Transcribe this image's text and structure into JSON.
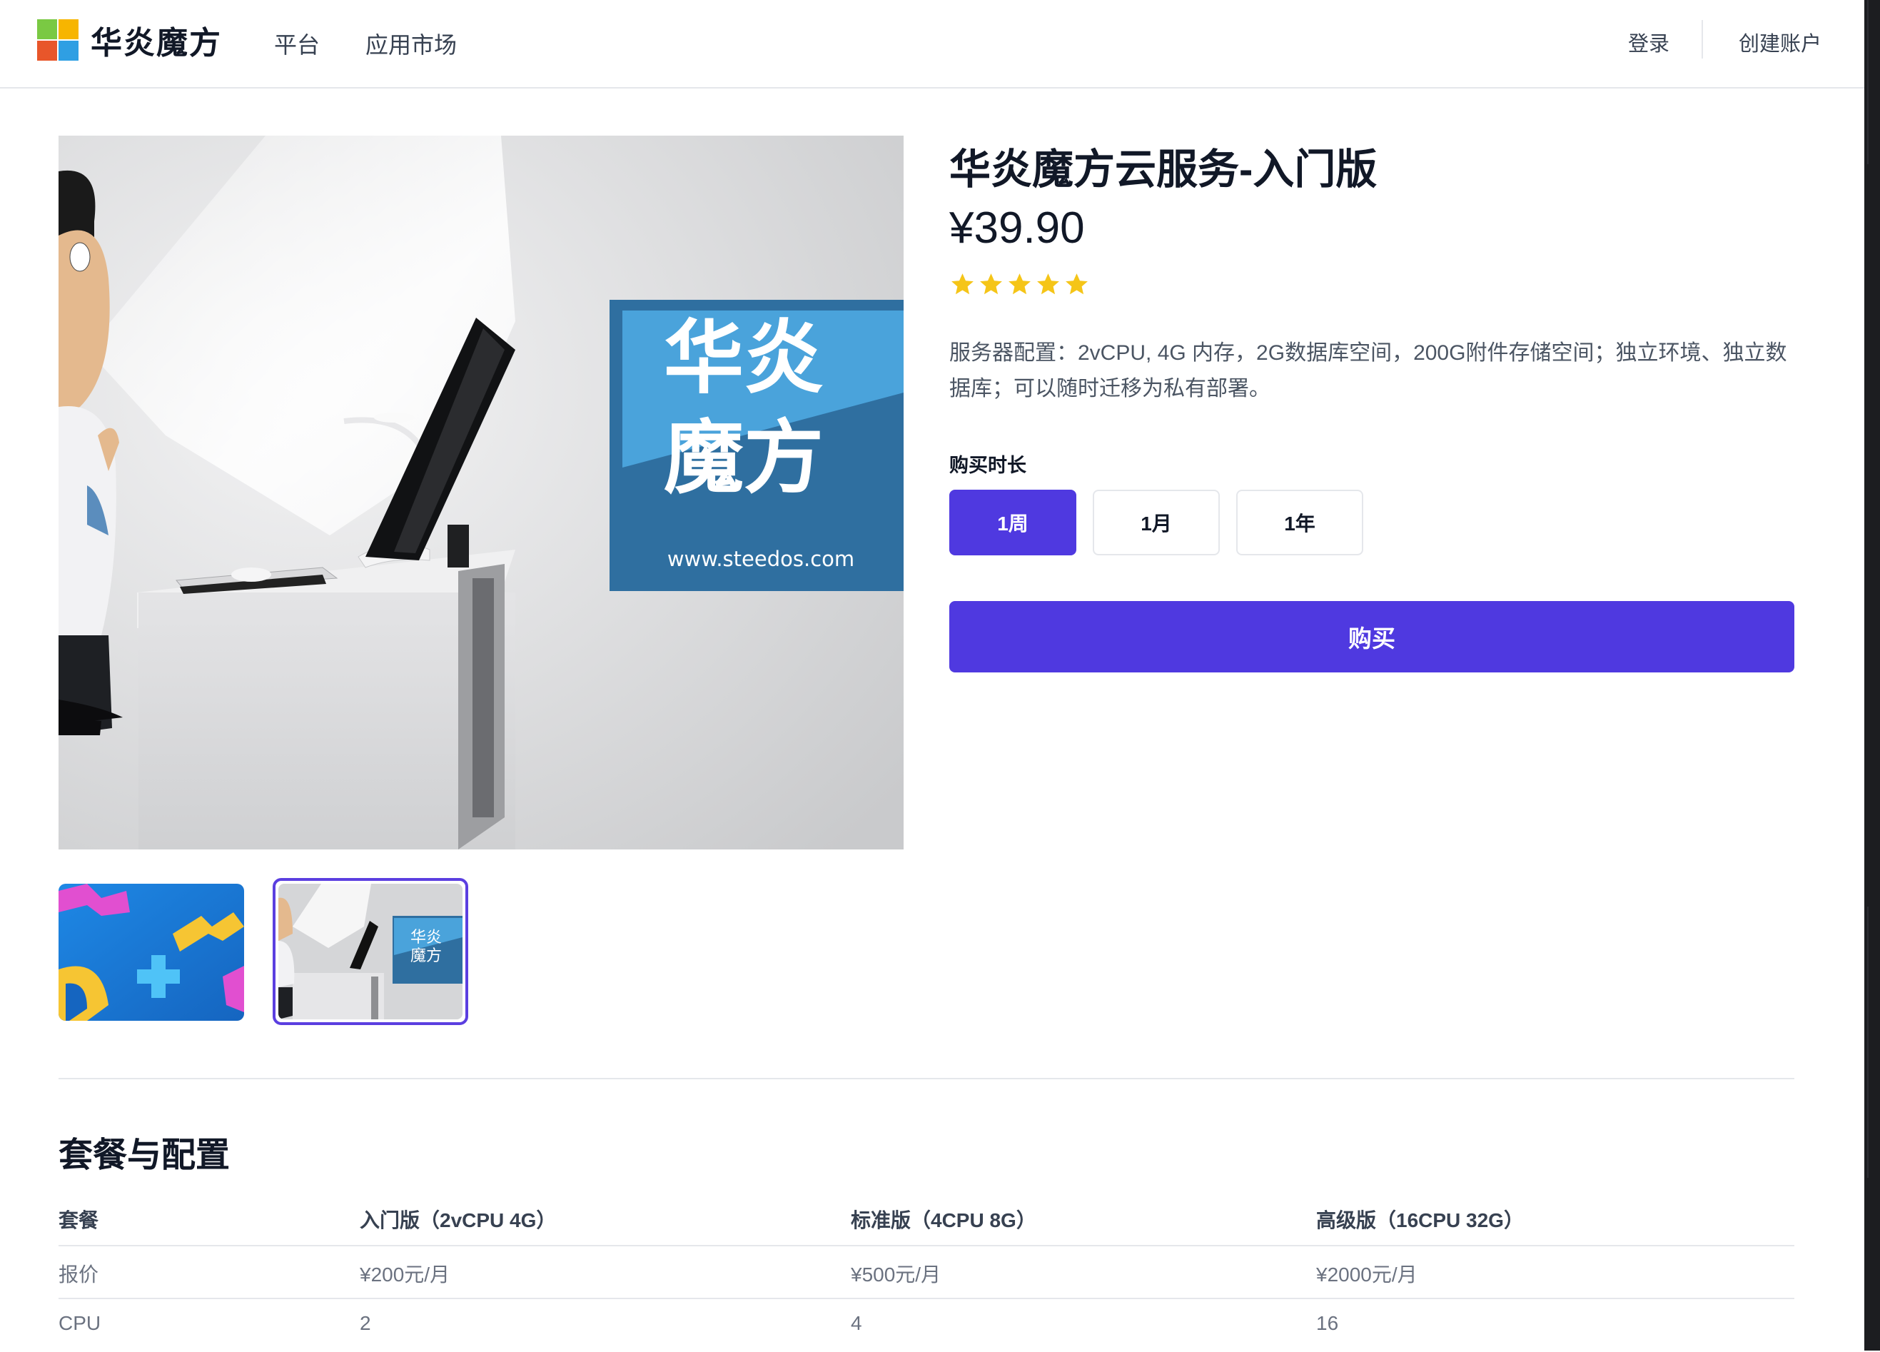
{
  "header": {
    "brand": "华炎魔方",
    "nav": [
      "平台",
      "应用市场"
    ],
    "login": "登录",
    "signup": "创建账户",
    "logo_colors": [
      "#7ac943",
      "#f7b500",
      "#e8562a",
      "#2f9fe3"
    ]
  },
  "gallery": {
    "main_image_text": {
      "line1": "华炎",
      "line2": "魔方",
      "url": "www.steedos.com"
    },
    "thumb_image_text": {
      "line1": "华炎",
      "line2": "魔方"
    },
    "selected_thumb": 2
  },
  "product": {
    "title": "华炎魔方云服务-入门版",
    "price": "¥39.90",
    "rating": 5,
    "rating_max": 5,
    "description": "服务器配置：2vCPU, 4G 内存，2G数据库空间，200G附件存储空间；独立环境、独立数据库；可以随时迁移为私有部署。",
    "duration_label": "购买时长",
    "durations": [
      "1周",
      "1月",
      "1年"
    ],
    "selected_duration": "1周",
    "buy_label": "购买",
    "accent_color": "#4f39e0",
    "star_color": "#f5c518"
  },
  "plans": {
    "title": "套餐与配置",
    "columns": [
      "套餐",
      "入门版（2vCPU 4G）",
      "标准版（4CPU 8G）",
      "高级版（16CPU 32G）"
    ],
    "rows": [
      [
        "报价",
        "¥200元/月",
        "¥500元/月",
        "¥2000元/月"
      ],
      [
        "CPU",
        "2",
        "4",
        "16"
      ]
    ]
  }
}
